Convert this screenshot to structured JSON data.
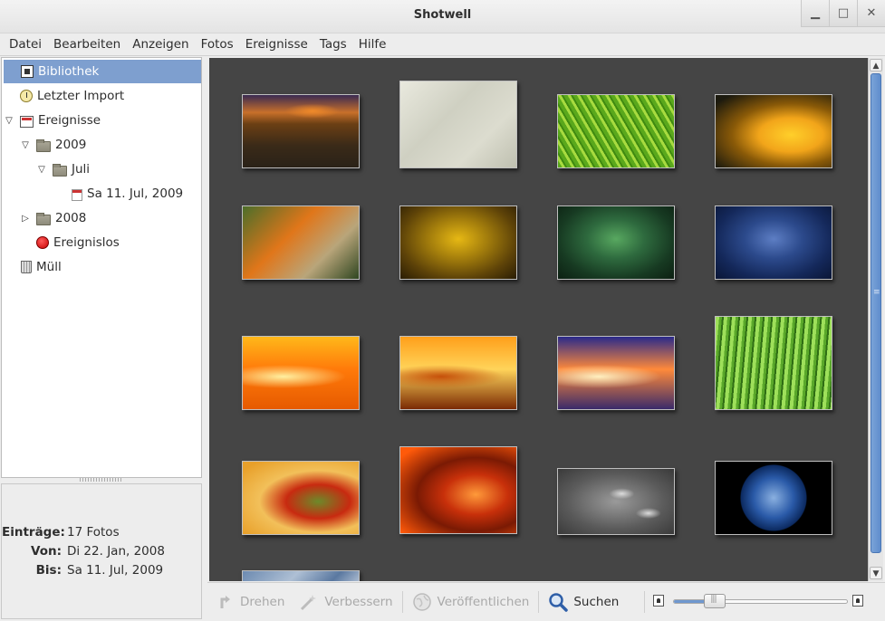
{
  "window": {
    "title": "Shotwell",
    "buttons": [
      "minimize-icon",
      "maximize-icon",
      "close-icon"
    ]
  },
  "menu": [
    "Datei",
    "Bearbeiten",
    "Anzeigen",
    "Fotos",
    "Ereignisse",
    "Tags",
    "Hilfe"
  ],
  "sidebar": {
    "items": [
      {
        "label": "Bibliothek",
        "icon": "library-icon",
        "selected": true
      },
      {
        "label": "Letzter Import",
        "icon": "clock-icon"
      },
      {
        "label": "Ereignisse",
        "icon": "events-icon",
        "expanded": true
      },
      {
        "label": "2009",
        "icon": "folder-icon",
        "expanded": true
      },
      {
        "label": "Juli",
        "icon": "folder-icon",
        "expanded": true
      },
      {
        "label": "Sa 11. Jul, 2009",
        "icon": "calendar-icon"
      },
      {
        "label": "2008",
        "icon": "folder-icon",
        "expanded": false
      },
      {
        "label": "Ereignislos",
        "icon": "no-event-icon"
      },
      {
        "label": "Müll",
        "icon": "trash-icon"
      }
    ]
  },
  "info": {
    "rows": [
      {
        "key": "Einträge:",
        "value": "17 Fotos"
      },
      {
        "key": "Von:",
        "value": "Di 22. Jan, 2008"
      },
      {
        "key": "Bis:",
        "value": "Sa 11. Jul, 2009"
      }
    ]
  },
  "photos": [
    {
      "name": "desert-sunset",
      "colors": [
        "#2a2218",
        "#6b3f14",
        "#c8702a",
        "#3a2a18"
      ]
    },
    {
      "name": "sand-texture",
      "colors": [
        "#e9e9de",
        "#cfd0c2",
        "#dcdccf",
        "#bfc0b0"
      ]
    },
    {
      "name": "green-leaf",
      "colors": [
        "#5aa81c",
        "#a7db3f",
        "#3f8a10",
        "#86c82c"
      ]
    },
    {
      "name": "yellow-flower",
      "colors": [
        "#1c1a0e",
        "#f2a51a",
        "#ffcf2a",
        "#8a5a08"
      ]
    },
    {
      "name": "dandelion-orange",
      "colors": [
        "#4c6e2a",
        "#e0761a",
        "#b9a57a",
        "#2f4620"
      ]
    },
    {
      "name": "gold-vignette",
      "colors": [
        "#e6b814",
        "#a47e0c",
        "#5e4308",
        "#2a1d04"
      ]
    },
    {
      "name": "green-vignette",
      "colors": [
        "#58a860",
        "#2e6a3e",
        "#173a22",
        "#0c2012"
      ]
    },
    {
      "name": "blue-vignette",
      "colors": [
        "#5d7ec4",
        "#2c4a8c",
        "#14285a",
        "#0a1636"
      ]
    },
    {
      "name": "orange-bokeh-1",
      "colors": [
        "#ffb81a",
        "#ff7a0a",
        "#fff0a0",
        "#e65a00"
      ]
    },
    {
      "name": "orange-bokeh-2",
      "colors": [
        "#ff9f1a",
        "#ffd45a",
        "#c6500a",
        "#7a2a04"
      ]
    },
    {
      "name": "purple-bokeh",
      "colors": [
        "#2a2a8a",
        "#ff8a3a",
        "#fff0c0",
        "#3a2a6a"
      ]
    },
    {
      "name": "grass",
      "colors": [
        "#9ee05a",
        "#5aa82a",
        "#2f6e14",
        "#c6f08a"
      ]
    },
    {
      "name": "red-flower",
      "colors": [
        "#e8a02a",
        "#c82a10",
        "#6c8a2a",
        "#f2c05a"
      ]
    },
    {
      "name": "orange-petals",
      "colors": [
        "#ff5a0a",
        "#c8300a",
        "#ff9a3a",
        "#7a1a04"
      ]
    },
    {
      "name": "water-footprints",
      "colors": [
        "#9a9a9a",
        "#5a5a5a",
        "#dcdcdc",
        "#3a3a3a"
      ]
    },
    {
      "name": "earth",
      "colors": [
        "#000000",
        "#2a5aa8",
        "#8ab0e0",
        "#e0e0e0"
      ]
    },
    {
      "name": "partial-sky",
      "colors": [
        "#6c8ab0",
        "#aebfd4",
        "#5a78a0",
        "#d4dde8"
      ]
    }
  ],
  "toolbar": {
    "rotate": {
      "label": "Drehen",
      "enabled": false,
      "icon": "rotate-icon"
    },
    "enhance": {
      "label": "Verbessern",
      "enabled": false,
      "icon": "enhance-icon"
    },
    "publish": {
      "label": "Veröffentlichen",
      "enabled": false,
      "icon": "publish-icon"
    },
    "search": {
      "label": "Suchen",
      "enabled": true,
      "icon": "search-icon"
    },
    "zoom": {
      "value": 0.2,
      "min_icon": "zoom-small-icon",
      "max_icon": "zoom-large-icon"
    }
  },
  "accent": "#7e9fcf"
}
